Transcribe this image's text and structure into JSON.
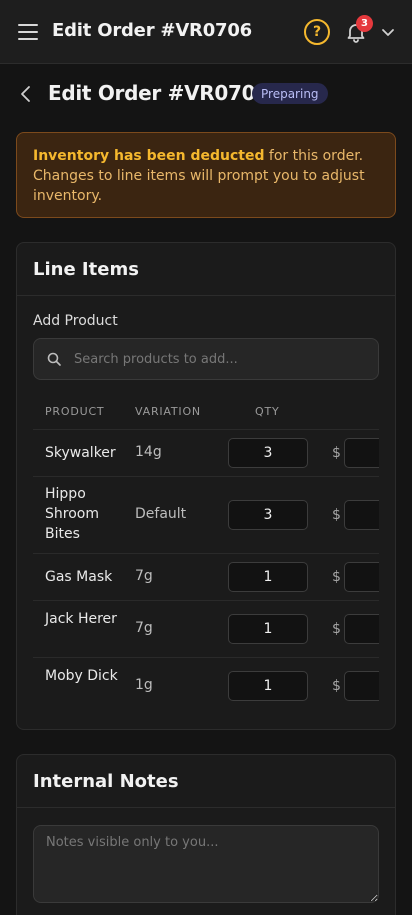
{
  "appbar": {
    "title": "Edit Order #VR0706",
    "help_glyph": "?",
    "notification_count": "3",
    "icons": [
      "menu-icon",
      "help-icon",
      "bell-icon",
      "chevron-down-icon"
    ]
  },
  "page": {
    "back_icon": "chevron-left-icon",
    "title": "Edit Order #VR0706",
    "status": "Preparing"
  },
  "alert": {
    "bold": "Inventory has been deducted",
    "text": " for this order. Changes to line items will prompt you to adjust inventory."
  },
  "line_items": {
    "title": "Line Items",
    "add_product_label": "Add Product",
    "search_placeholder": "Search products to add...",
    "columns": {
      "product": "PRODUCT",
      "variation": "VARIATION",
      "qty": "QTY"
    },
    "currency_symbol": "$",
    "rows": [
      {
        "product": "Skywalker",
        "variation": "14g",
        "qty": "3"
      },
      {
        "product": "Hippo Shroom Bites",
        "variation": "Default",
        "qty": "3"
      },
      {
        "product": "Gas Mask",
        "variation": "7g",
        "qty": "1"
      },
      {
        "product": "Jack Herer",
        "variation": "7g",
        "qty": "1"
      },
      {
        "product": "Moby Dick",
        "variation": "1g",
        "qty": "1"
      }
    ]
  },
  "internal_notes": {
    "title": "Internal Notes",
    "placeholder": "Notes visible only to you..."
  },
  "colors": {
    "background": "#141414",
    "surface": "#1b1b1b",
    "accent": "#f5b82e",
    "badge_red": "#e5393d",
    "status_bg": "#27284c",
    "status_text": "#b9bdf5",
    "alert_bg": "#3b2511"
  }
}
